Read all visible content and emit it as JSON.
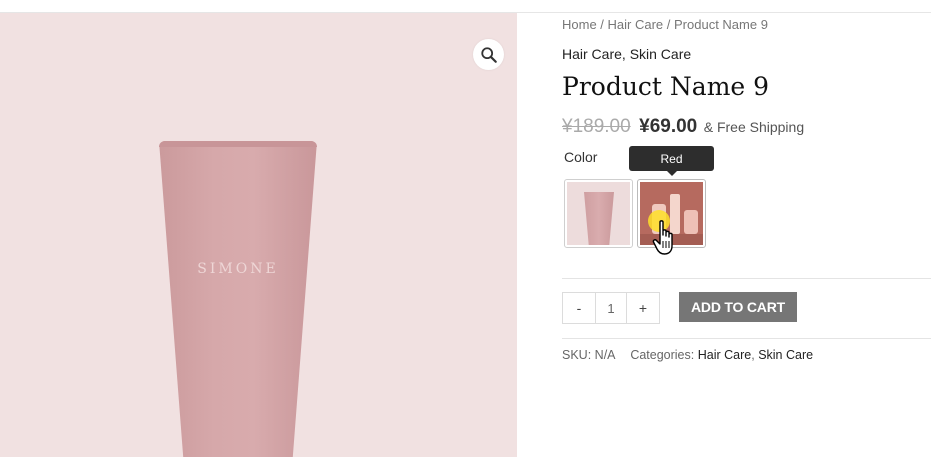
{
  "gallery": {
    "brand_text": "SIMONE",
    "zoom_icon": "magnifier-icon"
  },
  "breadcrumb": {
    "home": "Home",
    "sep1": " / ",
    "category": "Hair Care",
    "sep2": " / ",
    "current": "Product Name 9"
  },
  "product": {
    "categories_top": [
      "Hair Care",
      "Skin Care"
    ],
    "title": "Product Name 9",
    "price_old": "¥189.00",
    "price_new": "¥69.00",
    "shipping": "& Free Shipping"
  },
  "variations": {
    "label": "Color",
    "tooltip": "Red",
    "swatches": [
      "pink-tube-swatch",
      "red-swatch"
    ]
  },
  "cart": {
    "minus": "-",
    "quantity": "1",
    "plus": "+",
    "add_to_cart": "ADD TO CART"
  },
  "meta": {
    "sku_label": "SKU:",
    "sku_value": "N/A",
    "categories_label": "Categories:",
    "categories": [
      "Hair Care",
      "Skin Care"
    ]
  },
  "colors": {
    "gallery_bg": "#f1e1e1",
    "tube": "#d6a8aa",
    "button": "#767676",
    "red_swatch": "#b66a5f"
  }
}
